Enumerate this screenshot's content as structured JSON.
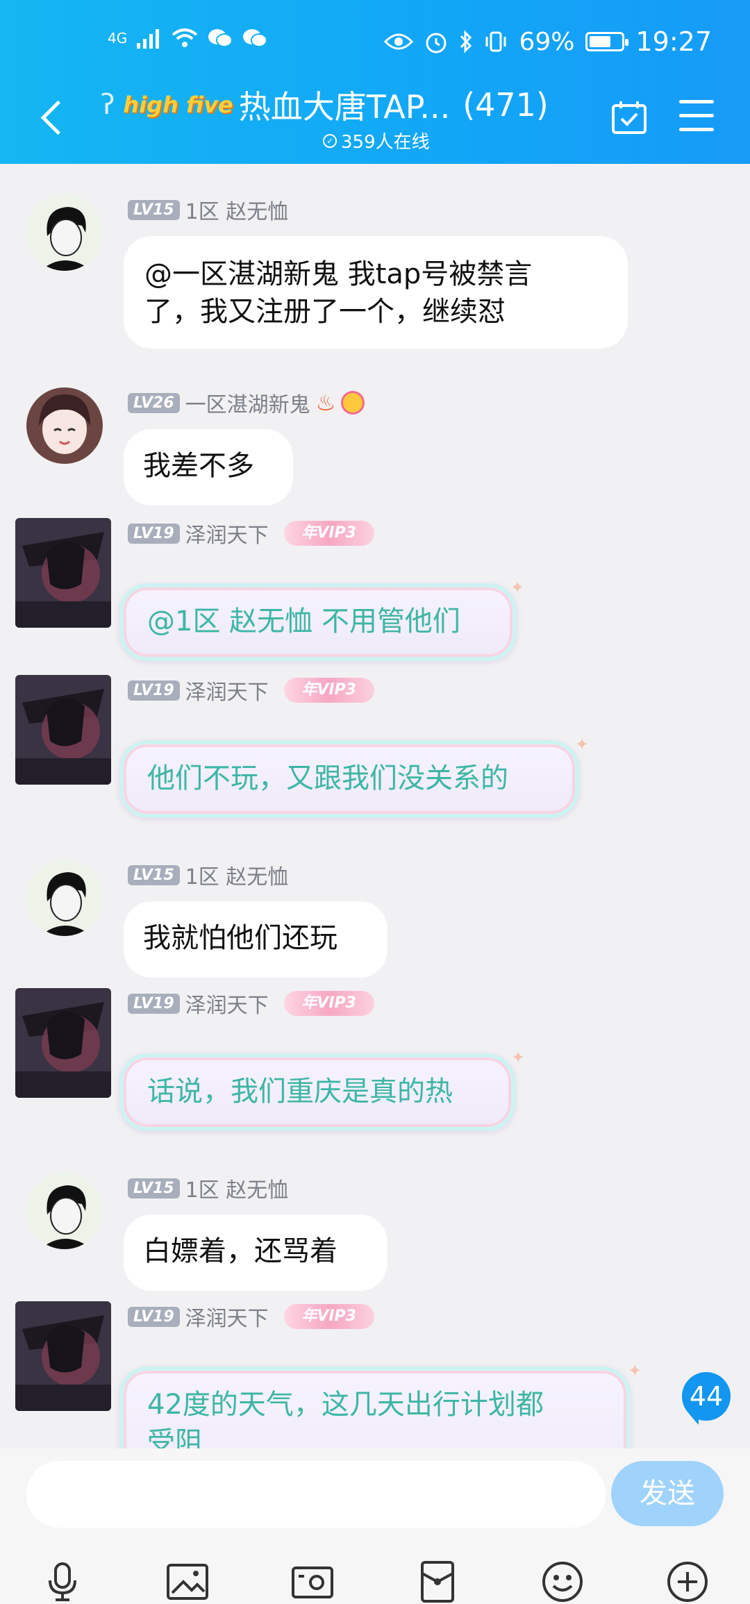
{
  "status_bar": {
    "network": "4G",
    "battery_percent": "69%",
    "battery_level": 0.69,
    "time": "19:27",
    "left_icons": [
      "signal-icon",
      "wifi-icon",
      "wechat-icon",
      "wechat-icon"
    ],
    "right_icons": [
      "eye-icon",
      "alarm-icon",
      "bluetooth-icon",
      "vibrate-icon"
    ]
  },
  "header": {
    "badge": "high five",
    "title": "热血大唐TAP...",
    "member_count": "(471)",
    "online": "359人在线"
  },
  "messages": [
    {
      "level": "LV15",
      "sender": "1区 赵无恤",
      "text_line1": "@一区湛湖新鬼 我tap号被禁言",
      "text_line2": "了，我又注册了一个，继续怼",
      "vip": false
    },
    {
      "level": "LV26",
      "sender": "一区湛湖新鬼",
      "badges": [
        "fire-icon",
        "smiley-badge-icon"
      ],
      "text": "我差不多",
      "vip": false
    },
    {
      "level": "LV19",
      "sender": "泽润天下",
      "vip_label": "年VIP3",
      "text": "@1区 赵无恤 不用管他们",
      "vip": true
    },
    {
      "level": "LV19",
      "sender": "泽润天下",
      "vip_label": "年VIP3",
      "text": "他们不玩，又跟我们没关系的",
      "vip": true
    },
    {
      "level": "LV15",
      "sender": "1区 赵无恤",
      "text": "我就怕他们还玩",
      "vip": false
    },
    {
      "level": "LV19",
      "sender": "泽润天下",
      "vip_label": "年VIP3",
      "text": "话说，我们重庆是真的热",
      "vip": true
    },
    {
      "level": "LV15",
      "sender": "1区 赵无恤",
      "text": "白嫖着，还骂着",
      "vip": false
    },
    {
      "level": "LV19",
      "sender": "泽润天下",
      "vip_label": "年VIP3",
      "text_line1": "42度的天气，这几天出行计划都",
      "text_line2": "受阻",
      "vip": true
    }
  ],
  "unread_count": "44",
  "input": {
    "placeholder": "",
    "send_label": "发送"
  },
  "toolbar": [
    "microphone-icon",
    "image-icon",
    "camera-icon",
    "red-packet-icon",
    "emoji-icon",
    "plus-icon"
  ],
  "colors": {
    "header": "#12a6f7",
    "vip_text": "#3db6a6",
    "send": "#9fd3fb"
  }
}
